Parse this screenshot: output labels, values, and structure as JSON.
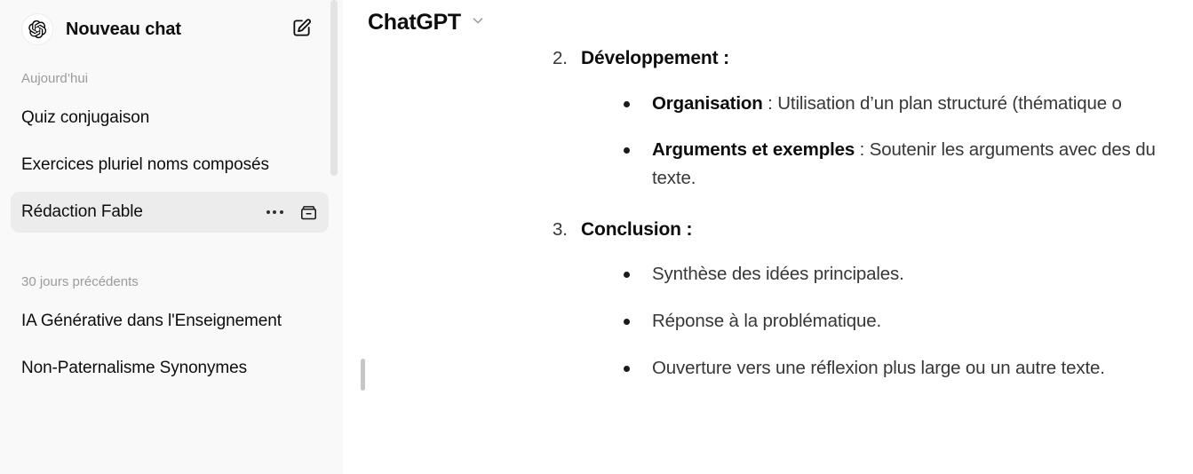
{
  "sidebar": {
    "brand": {
      "logo_icon": "openai-logo-icon",
      "label": "Nouveau chat"
    },
    "new_chat_icon": "new-chat-pencil-square-icon",
    "groups": [
      {
        "label": "Aujourd’hui",
        "items": [
          {
            "label": "Quiz conjugaison",
            "active": false
          },
          {
            "label": "Exercices pluriel noms composés",
            "active": false
          },
          {
            "label": "Rédaction Fable",
            "active": true,
            "more_icon": "more-options-dots-icon",
            "archive_icon": "archive-box-icon"
          }
        ]
      },
      {
        "label": "30 jours précédents",
        "items": [
          {
            "label": "IA Générative dans l'Enseignement",
            "active": false
          },
          {
            "label": "Non-Paternalisme Synonymes",
            "active": false
          }
        ]
      }
    ],
    "scrollbar": {
      "name": "sidebar-scrollbar"
    },
    "colors": {
      "background": "#f9f9f9",
      "active_item": "#ececec",
      "group_label": "#9b9b9b"
    }
  },
  "header": {
    "model_name": "ChatGPT",
    "chevron_icon": "chevron-down-icon"
  },
  "message": {
    "sections": [
      {
        "number": "2.",
        "heading": "Développement :",
        "bullets": [
          {
            "strong": "Organisation",
            "separator": " : ",
            "text": "Utilisation d’un plan structuré (thématique o"
          },
          {
            "strong": "Arguments et exemples",
            "separator": " : ",
            "text": "Soutenir les arguments avec des",
            "continuation": "du texte."
          }
        ]
      },
      {
        "number": "3.",
        "heading": "Conclusion :",
        "bullets": [
          {
            "strong": "",
            "separator": "",
            "text": "Synthèse des idées principales."
          },
          {
            "strong": "",
            "separator": "",
            "text": "Réponse à la problématique."
          },
          {
            "strong": "",
            "separator": "",
            "text": "Ouverture vers une réflexion plus large ou un autre texte."
          }
        ]
      }
    ],
    "text_color": "#373737"
  },
  "resize_handle": {
    "name": "sidebar-resize-handle"
  }
}
